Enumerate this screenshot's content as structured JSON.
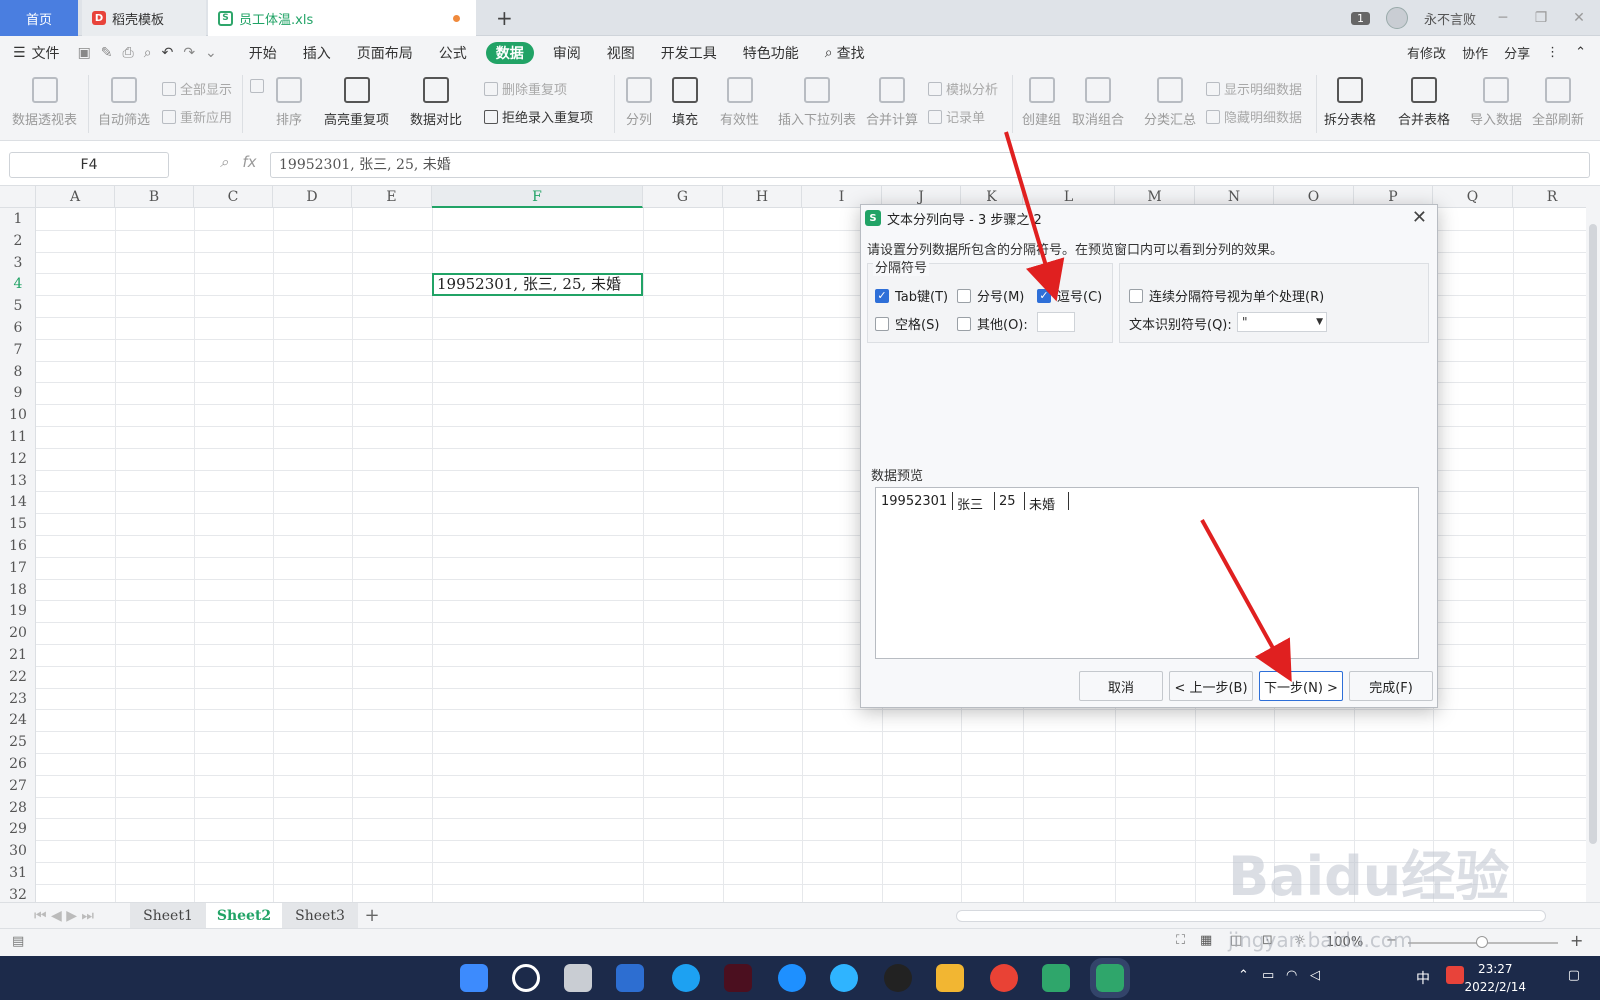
{
  "tabs": {
    "home": "首页",
    "daoke": "稻壳模板",
    "file": "员工体温.xls",
    "new": "+"
  },
  "titlebar": {
    "badge": "1",
    "user": "永不言败"
  },
  "menu": {
    "file": "文件",
    "items": [
      "开始",
      "插入",
      "页面布局",
      "公式",
      "数据",
      "审阅",
      "视图",
      "开发工具",
      "特色功能"
    ],
    "active": "数据",
    "search": "查找",
    "right": [
      "有修改",
      "协作",
      "分享"
    ]
  },
  "ribbon": {
    "pivot": "数据透视表",
    "autofilter": "自动筛选",
    "showall": "全部显示",
    "reapply": "重新应用",
    "sort": "排序",
    "highlight_dup": "高亮重复项",
    "compare": "数据对比",
    "del_dup": "删除重复项",
    "reject_dup": "拒绝录入重复项",
    "split": "分列",
    "fill": "填充",
    "validity": "有效性",
    "dropdown": "插入下拉列表",
    "consolidate": "合并计算",
    "whatif": "模拟分析",
    "record": "记录单",
    "group": "创建组",
    "ungroup": "取消组合",
    "subtotal": "分类汇总",
    "show_detail": "显示明细数据",
    "hide_detail": "隐藏明细数据",
    "split_table": "拆分表格",
    "merge_table": "合并表格",
    "import": "导入数据",
    "refresh": "全部刷新"
  },
  "formula_bar": {
    "cell_ref": "F4",
    "value": "19952301, 张三, 25, 未婚"
  },
  "grid": {
    "columns": [
      "A",
      "B",
      "C",
      "D",
      "E",
      "F",
      "G",
      "H",
      "I",
      "J",
      "K",
      "L",
      "M",
      "N",
      "O",
      "P",
      "Q",
      "R"
    ],
    "rows": [
      "1",
      "2",
      "3",
      "4",
      "5",
      "6",
      "7",
      "8",
      "9",
      "10",
      "11",
      "12",
      "13",
      "14",
      "15",
      "16",
      "17",
      "18",
      "19",
      "20",
      "21",
      "22",
      "23",
      "24",
      "25",
      "26",
      "27",
      "28",
      "29",
      "30",
      "31",
      "32"
    ],
    "active_cell_value": "19952301, 张三, 25, 未婚"
  },
  "sheets": [
    "Sheet1",
    "Sheet2",
    "Sheet3"
  ],
  "active_sheet": "Sheet2",
  "status": {
    "zoom": "100%"
  },
  "dialog": {
    "title": "文本分列向导 - 3 步骤之 2",
    "description": "请设置分列数据所包含的分隔符号。在预览窗口内可以看到分列的效果。",
    "delimiter_group": "分隔符号",
    "tab": "Tab键(T)",
    "semicolon": "分号(M)",
    "comma": "逗号(C)",
    "space": "空格(S)",
    "other": "其他(O):",
    "consecutive": "连续分隔符号视为单个处理(R)",
    "qualifier_label": "文本识别符号(Q):",
    "qualifier_value": "\"",
    "preview_label": "数据预览",
    "preview": [
      "19952301",
      "张三",
      "25",
      "未婚"
    ],
    "cancel": "取消",
    "back": "< 上一步(B)",
    "next": "下一步(N) >",
    "finish": "完成(F)",
    "checked": {
      "tab": true,
      "semicolon": false,
      "comma": true,
      "space": false,
      "other": false,
      "consecutive": false
    }
  },
  "taskbar": {
    "time": "23:27",
    "date": "2022/2/14",
    "ime": "中"
  },
  "watermark": {
    "brand": "Baidu经验",
    "url": "jingyan.baidu.com"
  }
}
